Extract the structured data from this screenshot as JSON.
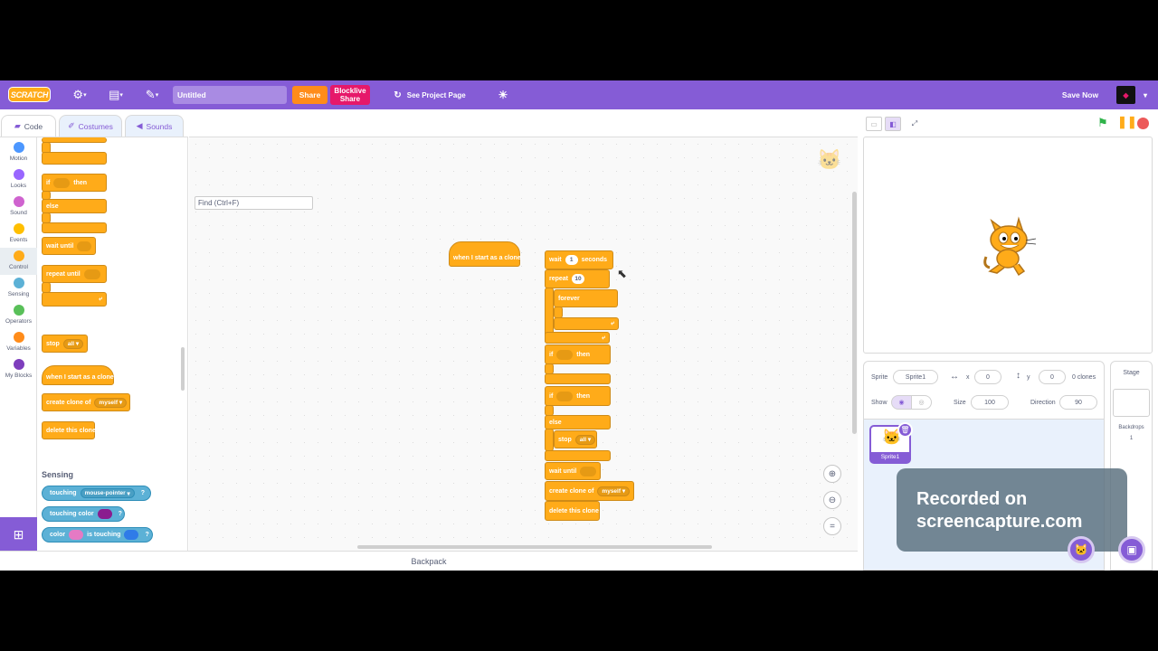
{
  "topbar": {
    "logo": "SCRATCH",
    "title_value": "Untitled",
    "share_label": "Share",
    "blocklive_line1": "Blocklive",
    "blocklive_line2": "Share",
    "see_project_label": "See Project Page",
    "save_now_label": "Save Now"
  },
  "tabs": [
    {
      "label": "Code"
    },
    {
      "label": "Costumes"
    },
    {
      "label": "Sounds"
    }
  ],
  "find": {
    "placeholder": "Find (Ctrl+F)"
  },
  "categories": [
    {
      "label": "Motion",
      "color": "#4c97ff"
    },
    {
      "label": "Looks",
      "color": "#9966ff"
    },
    {
      "label": "Sound",
      "color": "#cf63cf"
    },
    {
      "label": "Events",
      "color": "#ffbf00"
    },
    {
      "label": "Control",
      "color": "#ffab19"
    },
    {
      "label": "Sensing",
      "color": "#5cb1d6"
    },
    {
      "label": "Operators",
      "color": "#59c059"
    },
    {
      "label": "Variables",
      "color": "#ff8c1a"
    },
    {
      "label": "My Blocks",
      "color": "#7e3ebd"
    }
  ],
  "palette": {
    "if": "if",
    "then": "then",
    "else": "else",
    "wait_until": "wait until",
    "repeat_until": "repeat until",
    "stop": "stop",
    "stop_option": "all",
    "when_clone": "when I start as a clone",
    "create_clone": "create clone of",
    "create_clone_option": "myself",
    "delete_clone": "delete this clone",
    "sensing_heading": "Sensing",
    "touching": "touching",
    "touching_option": "mouse-pointer",
    "touching_color": "touching color",
    "color": "color",
    "is_touching": "is touching",
    "question": "?",
    "loop_arrow": "⤶"
  },
  "workspace": {
    "hat_label": "when I start as a clone",
    "wait": "wait",
    "wait_value": "1",
    "seconds": "seconds",
    "repeat": "repeat",
    "repeat_value": "10",
    "forever": "forever",
    "if": "if",
    "then": "then",
    "else": "else",
    "stop": "stop",
    "stop_option": "all",
    "wait_until": "wait until",
    "create_clone": "create clone of",
    "create_clone_option": "myself",
    "delete_clone": "delete this clone"
  },
  "backpack_label": "Backpack",
  "sprite_info": {
    "sprite_label": "Sprite",
    "sprite_name": "Sprite1",
    "x_label": "x",
    "x_value": "0",
    "y_label": "y",
    "y_value": "0",
    "clones": "0 clones",
    "show_label": "Show",
    "size_label": "Size",
    "size_value": "100",
    "direction_label": "Direction",
    "direction_value": "90"
  },
  "sprite_list": [
    {
      "name": "Sprite1"
    }
  ],
  "stage_panel": {
    "title": "Stage",
    "backdrops_label": "Backdrops",
    "backdrops_count": "1"
  },
  "watermark": {
    "line1": "Recorded on",
    "line2": "screencapture.com"
  },
  "colors": {
    "accent": "#855cd6",
    "control": "#ffab19",
    "sensing": "#5cb1d6",
    "share": "#ff8c1a",
    "blocklive": "#e6186a"
  }
}
